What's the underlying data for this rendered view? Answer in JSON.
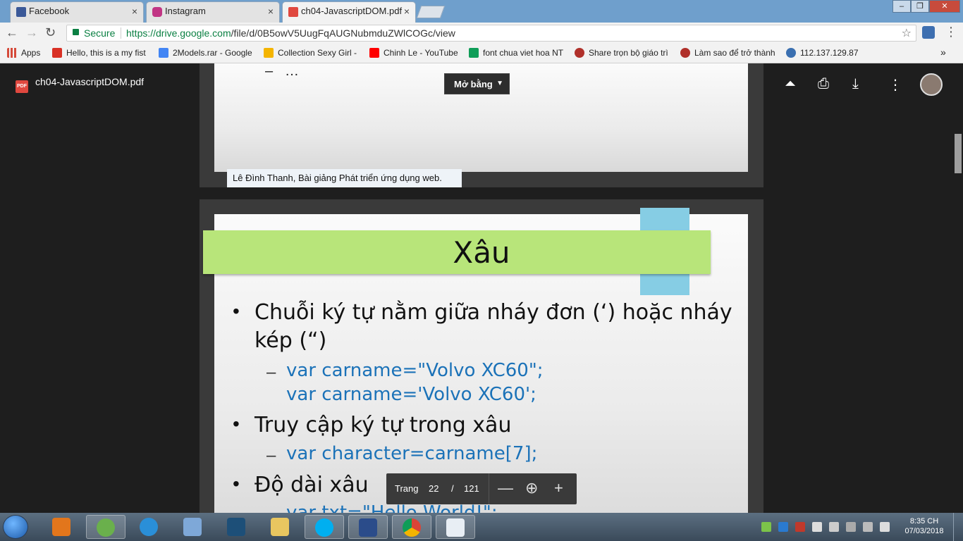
{
  "tabs": [
    {
      "title": "Facebook",
      "close": "×",
      "icon_color": "#3b5998"
    },
    {
      "title": "Instagram",
      "close": "×",
      "icon_color": "#c13584"
    },
    {
      "title": "ch04-JavascriptDOM.pdf",
      "close": "×",
      "icon_color": "#e0483f",
      "active": true
    }
  ],
  "window_controls": {
    "minimize": "–",
    "maximize": "❐",
    "close": "✕"
  },
  "toolbar": {
    "back": "←",
    "forward": "→",
    "reload": "↻",
    "secure_label": "Secure",
    "url_scheme_host": "https://drive.google.com",
    "url_path": "/file/d/0B5owV5UugFqAUGNubmduZWlCOGc/view",
    "star": "☆",
    "menu": "⋮"
  },
  "bookmarks": [
    {
      "label": "Apps",
      "icon_color": "#d54a3a"
    },
    {
      "label": "Hello, this is a my fist",
      "icon_color": "#d93025"
    },
    {
      "label": "2Models.rar - Google",
      "icon_color": "#4285f4"
    },
    {
      "label": "Collection Sexy Girl -",
      "icon_color": "#f4b400"
    },
    {
      "label": "Chinh Le - YouTube",
      "icon_color": "#ff0000"
    },
    {
      "label": "font chua viet hoa NT",
      "icon_color": "#0f9d58"
    },
    {
      "label": "Share trọn bộ giáo trì",
      "icon_color": "#b0302a"
    },
    {
      "label": "Làm sao để trở thành",
      "icon_color": "#b0302a"
    },
    {
      "label": "112.137.129.87",
      "icon_color": "#3a6fb0"
    }
  ],
  "bookmarks_more": "»",
  "viewer": {
    "file_name": "ch04-JavascriptDOM.pdf",
    "pdf_badge": "PDF",
    "open_with": "Mở bằng",
    "open_with_caret": "▼",
    "icons": {
      "add_to_drive": "⏶",
      "print": "⎙",
      "download": "⤓",
      "more": "⋮"
    }
  },
  "prev_page": {
    "dash": "–",
    "ellipsis": "…",
    "footer": "Lê Đình Thanh, Bài giảng Phát triển ứng dụng web."
  },
  "slide": {
    "title": "Xâu",
    "bullets": [
      {
        "text": "Chuỗi ký tự nằm giữa nháy đơn (‘) hoặc nháy",
        "continuation": "kép (“)"
      },
      {
        "text": "Truy cập ký tự trong xâu"
      },
      {
        "text": "Độ dài xâu"
      }
    ],
    "bullet_char": "•",
    "dash_char": "–",
    "code_lines": [
      "var carname=\"Volvo XC60\";",
      "var carname='Volvo XC60';",
      "var character=carname[7];",
      "var txt=\"Hello World!\";"
    ]
  },
  "page_toolbar": {
    "label": "Trang",
    "current": "22",
    "slash": "/",
    "total": "121",
    "zoom_out": "—",
    "zoom": "⊕",
    "zoom_in": "+"
  },
  "taskbar": {
    "time": "8:35 CH",
    "date": "07/03/2018"
  },
  "colors": {
    "title_band": "#b8e57a",
    "title_tab": "#86cde4",
    "code_text": "#1b72b8"
  }
}
